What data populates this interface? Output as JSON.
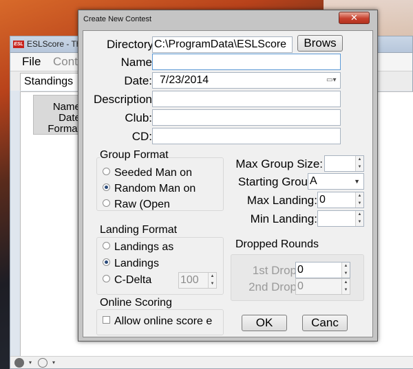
{
  "background_window": {
    "title": "ESLScore - The th",
    "app_icon_text": "ESL",
    "menu": {
      "file": "File",
      "contest": "Conte"
    },
    "tab": "Standings",
    "info_labels": [
      "Name:",
      "Date:",
      "Format."
    ]
  },
  "dialog": {
    "title": "Create New Contest",
    "close_glyph": "✕",
    "fields": {
      "directory": {
        "label": "Directory",
        "value": "C:\\ProgramData\\ESLScore",
        "browse": "Brows"
      },
      "name": {
        "label": "Name",
        "value": ""
      },
      "date": {
        "label": "Date:",
        "value": "7/23/2014",
        "icon": "calendar-icon"
      },
      "description": {
        "label": "Description",
        "value": ""
      },
      "club": {
        "label": "Club:",
        "value": ""
      },
      "cd": {
        "label": "CD:",
        "value": ""
      }
    },
    "group_format": {
      "title": "Group Format",
      "options": [
        {
          "label": "Seeded Man on",
          "selected": false
        },
        {
          "label": "Random Man on",
          "selected": true
        },
        {
          "label": "Raw (Open",
          "selected": false
        }
      ]
    },
    "landing_format": {
      "title": "Landing Format",
      "options": [
        {
          "label": "Landings as",
          "selected": false
        },
        {
          "label": "Landings",
          "selected": true
        },
        {
          "label": "C-Delta",
          "selected": false
        }
      ],
      "cdelta_value": "100"
    },
    "online_scoring": {
      "title": "Online Scoring",
      "checkbox_label": "Allow online score e",
      "checked": false
    },
    "right_panel": {
      "max_group_size": {
        "label": "Max Group Size:",
        "value": ""
      },
      "starting_group": {
        "label": "Starting Grou",
        "value": "A"
      },
      "max_landing": {
        "label": "Max Landing:",
        "value": "0"
      },
      "min_landing": {
        "label": "Min Landing:",
        "value": ""
      }
    },
    "dropped_rounds": {
      "title": "Dropped Rounds",
      "first_drop": {
        "label": "1st Drop",
        "value": "0"
      },
      "second_drop": {
        "label": "2nd Drop",
        "value": "0"
      }
    },
    "buttons": {
      "ok": "OK",
      "cancel": "Canc"
    }
  },
  "colors": {
    "dialog_frame": "#c5c5c5",
    "client_bg": "#f0f0f0",
    "close_button": "#c7412f",
    "radio_dot": "#2a4a7a"
  }
}
